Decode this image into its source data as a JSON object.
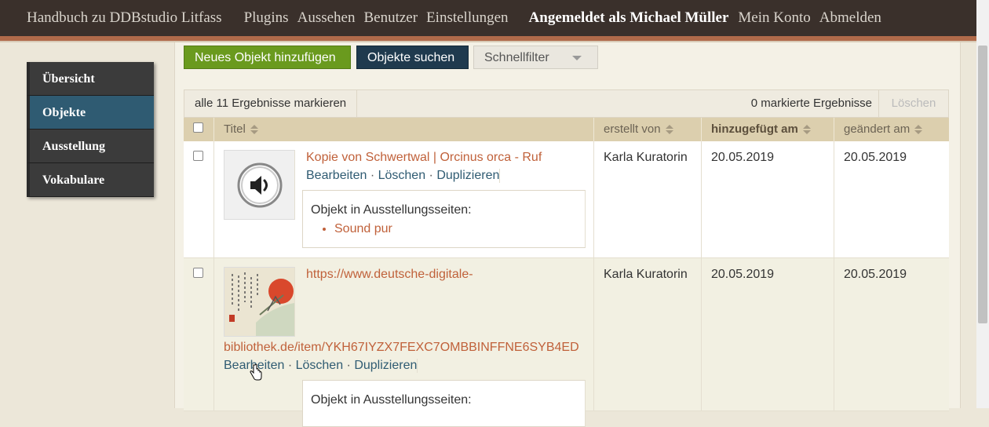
{
  "header": {
    "site_title": "Handbuch zu DDBstudio Litfass",
    "nav": [
      "Plugins",
      "Aussehen",
      "Benutzer",
      "Einstellungen"
    ],
    "user": "Angemeldet als Michael Müller",
    "account": [
      "Mein Konto",
      "Abmelden"
    ]
  },
  "sidebar": {
    "items": [
      {
        "label": "Übersicht",
        "active": false
      },
      {
        "label": "Objekte",
        "active": true
      },
      {
        "label": "Ausstellung",
        "active": false
      },
      {
        "label": "Vokabulare",
        "active": false
      }
    ]
  },
  "toolbar": {
    "add_label": "Neues Objekt hinzufügen",
    "search_label": "Objekte suchen",
    "filter_label": "Schnellfilter"
  },
  "table": {
    "mark_all": "alle 11 Ergebnisse markieren",
    "selected_count": "0 markierte Ergebnisse",
    "delete_label": "Löschen",
    "columns": [
      "Titel",
      "erstellt von",
      "hinzugefügt am",
      "geändert am"
    ],
    "rows": [
      {
        "title": "Kopie von Schwertwal | Orcinus orca - Ruf",
        "actions": [
          "Bearbeiten",
          "Löschen",
          "Duplizieren"
        ],
        "exhibit_heading": "Objekt in Ausstellungsseiten:",
        "exhibit_pages": [
          "Sound pur"
        ],
        "created_by": "Karla Kuratorin",
        "added": "20.05.2019",
        "changed": "20.05.2019"
      },
      {
        "title_line1": "https://www.deutsche-digitale-",
        "title_line2": "bibliothek.de/item/YKH67IYZX7FEXC7OMBBINFFNE6SYB4ED",
        "actions": [
          "Bearbeiten",
          "Löschen",
          "Duplizieren"
        ],
        "exhibit_heading": "Objekt in Ausstellungsseiten:",
        "created_by": "Karla Kuratorin",
        "added": "20.05.2019",
        "changed": "20.05.2019"
      }
    ]
  },
  "colors": {
    "header_bg": "#3a302b",
    "accent_line": "#b06a4a",
    "active_nav": "#2f5b72",
    "add_button": "#6a9a1e",
    "search_button": "#1f3a4e",
    "link": "#c0613a"
  }
}
